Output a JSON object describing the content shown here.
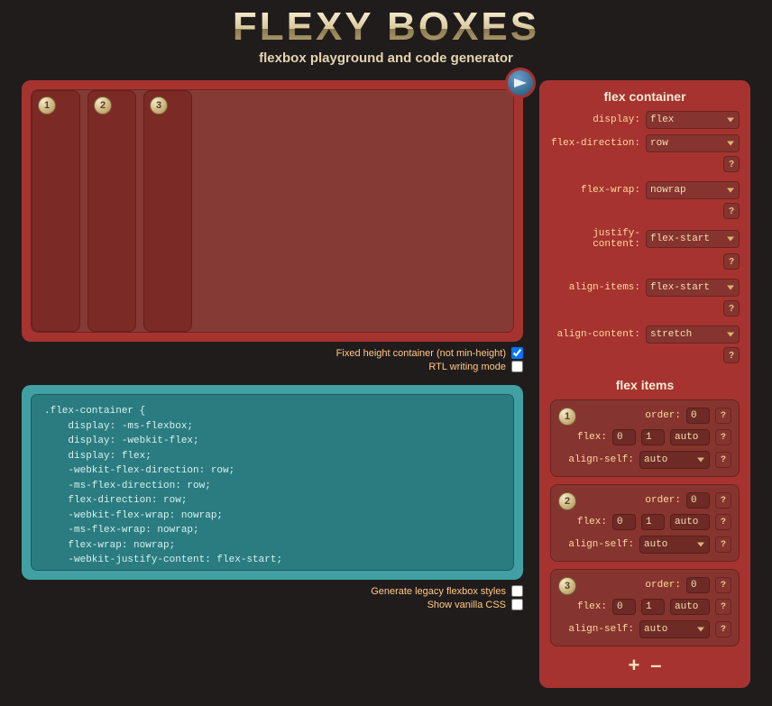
{
  "header": {
    "title": "FLEXY BOXES",
    "subtitle": "flexbox playground and code generator"
  },
  "preview": {
    "items": [
      "1",
      "2",
      "3"
    ]
  },
  "options_left": {
    "fixed_height": {
      "label": "Fixed height container (not min-height)",
      "checked": true
    },
    "rtl": {
      "label": "RTL writing mode",
      "checked": false
    },
    "legacy": {
      "label": "Generate legacy flexbox styles",
      "checked": false
    },
    "vanilla": {
      "label": "Show vanilla CSS",
      "checked": false
    }
  },
  "container_controls": {
    "heading": "flex container",
    "display": {
      "label": "display:",
      "value": "flex"
    },
    "flex_direction": {
      "label": "flex-direction:",
      "value": "row"
    },
    "flex_wrap": {
      "label": "flex-wrap:",
      "value": "nowrap"
    },
    "justify_content": {
      "label": "justify-content:",
      "value": "flex-start"
    },
    "align_items": {
      "label": "align-items:",
      "value": "flex-start"
    },
    "align_content": {
      "label": "align-content:",
      "value": "stretch"
    }
  },
  "item_controls": {
    "heading": "flex items",
    "labels": {
      "order": "order:",
      "flex": "flex:",
      "align_self": "align-self:"
    },
    "items": [
      {
        "num": "1",
        "order": "0",
        "grow": "0",
        "shrink": "1",
        "basis": "auto",
        "align_self": "auto"
      },
      {
        "num": "2",
        "order": "0",
        "grow": "0",
        "shrink": "1",
        "basis": "auto",
        "align_self": "auto"
      },
      {
        "num": "3",
        "order": "0",
        "grow": "0",
        "shrink": "1",
        "basis": "auto",
        "align_self": "auto"
      }
    ],
    "add": "+",
    "remove": "–"
  },
  "code": ".flex-container {\n    display: -ms-flexbox;\n    display: -webkit-flex;\n    display: flex;\n    -webkit-flex-direction: row;\n    -ms-flex-direction: row;\n    flex-direction: row;\n    -webkit-flex-wrap: nowrap;\n    -ms-flex-wrap: nowrap;\n    flex-wrap: nowrap;\n    -webkit-justify-content: flex-start;\n    -ms-flex-pack: start;\n    justify-content: flex-start;\n    -webkit-align-content: stretch;\n    -ms-flex-line-pack: stretch;\n    align-content: stretch;\n    }",
  "help": "?"
}
